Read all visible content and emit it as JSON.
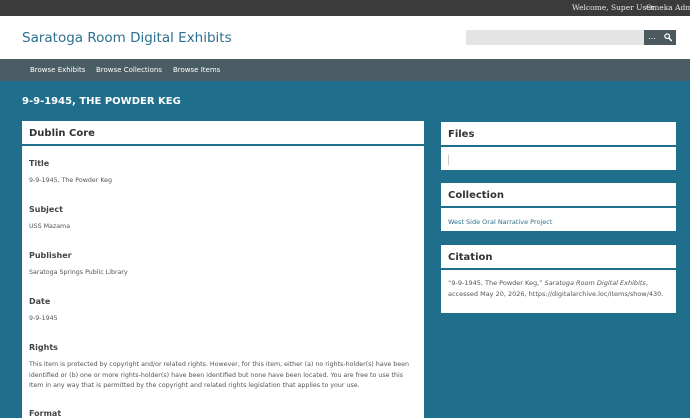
{
  "admin_bar": {
    "welcome": "Welcome, Super User",
    "admin_link": "Omeka Admin"
  },
  "header": {
    "site_title": "Saratoga Room Digital Exhibits",
    "search": {
      "placeholder": "",
      "options_label": "...",
      "submit_icon": "search-icon"
    }
  },
  "nav": {
    "items": [
      "Browse Exhibits",
      "Browse Collections",
      "Browse Items"
    ]
  },
  "page": {
    "title": "9-9-1945, THE POWDER KEG"
  },
  "dublin_core": {
    "heading": "Dublin Core",
    "fields": [
      {
        "label": "Title",
        "value": "9-9-1945, The Powder Keg"
      },
      {
        "label": "Subject",
        "value": "USS Mazama"
      },
      {
        "label": "Publisher",
        "value": "Saratoga Springs Public Library"
      },
      {
        "label": "Date",
        "value": "9-9-1945"
      },
      {
        "label": "Rights",
        "value": "This item is protected by copyright and/or related rights. However, for this item, either (a) no rights-holder(s) have been identified or (b) one or more rights-holder(s) have been identified but none have been located. You are free to use this Item in any way that is permitted by the copyright and related rights legislation that applies to your use."
      },
      {
        "label": "Format",
        "value": ""
      }
    ]
  },
  "files": {
    "heading": "Files"
  },
  "collection": {
    "heading": "Collection",
    "link": "West Side Oral Narrative Project"
  },
  "citation": {
    "heading": "Citation",
    "prefix": "“9-9-1945, The Powder Keg,” ",
    "site": "Saratoga Room Digital Exhibits",
    "suffix": ", accessed May 20, 2026, https://digitalarchive.loc/items/show/430."
  },
  "colors": {
    "admin_bar": "#3b3b3b",
    "nav_bar": "#4a5d64",
    "page_background": "#1f6e8c",
    "link": "#2c6f8f"
  }
}
